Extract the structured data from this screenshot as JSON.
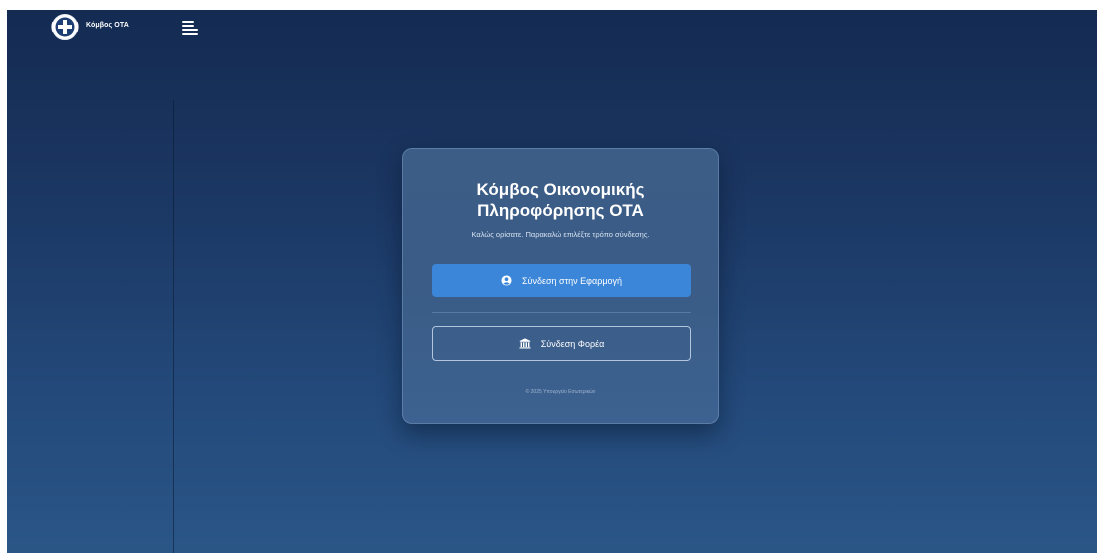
{
  "app": {
    "brand_name": "Κόμβος ΟΤΑ"
  },
  "login_card": {
    "title_line1": "Κόμβος Οικονομικής",
    "title_line2": "Πληροφόρησης ΟΤΑ",
    "subtitle": "Καλώς ορίσατε. Παρακαλώ επιλέξτε τρόπο σύνδεσης.",
    "app_login_label": "Σύνδεση στην Εφαρμογή",
    "org_login_label": "Σύνδεση Φορέα",
    "footer": "© 2025 Υπουργείο Εσωτερικών"
  },
  "icons": {
    "logo": "greek-cross-emblem-icon",
    "menu": "menu-icon",
    "user": "user-circle-icon",
    "institution": "institution-icon"
  },
  "colors": {
    "primary_button": "#3b86d8",
    "background_top": "#142b52",
    "background_bottom": "#2a5687"
  }
}
